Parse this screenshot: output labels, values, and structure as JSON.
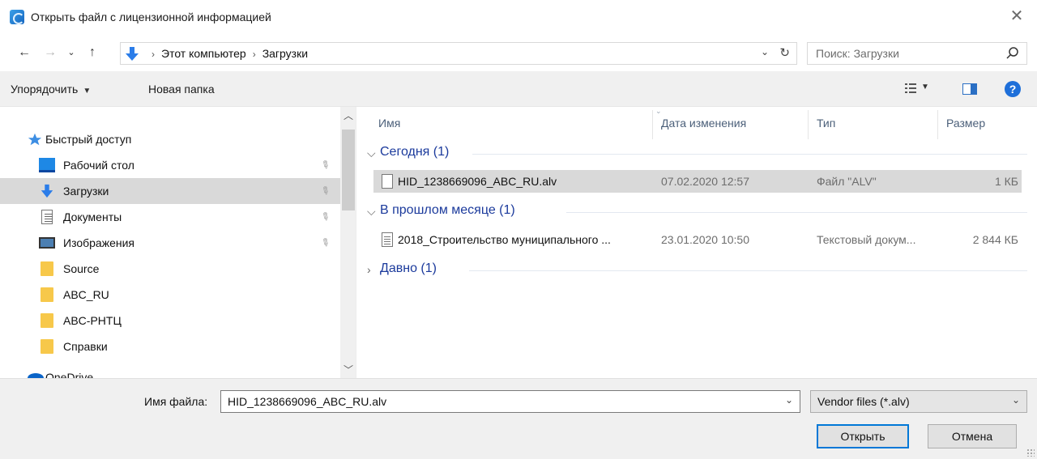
{
  "window": {
    "title": "Открыть файл с лицензионной информацией"
  },
  "navbar": {
    "breadcrumbs": [
      "Этот компьютер",
      "Загрузки"
    ],
    "search_placeholder": "Поиск: Загрузки"
  },
  "toolbar": {
    "organize_label": "Упорядочить",
    "new_folder_label": "Новая папка"
  },
  "sidebar": {
    "quick_access_label": "Быстрый доступ",
    "items": [
      {
        "label": "Рабочий стол",
        "icon": "desktop-icon",
        "pinned": true
      },
      {
        "label": "Загрузки",
        "icon": "downloads-icon",
        "pinned": true,
        "selected": true
      },
      {
        "label": "Документы",
        "icon": "documents-icon",
        "pinned": true
      },
      {
        "label": "Изображения",
        "icon": "pictures-icon",
        "pinned": true
      },
      {
        "label": "Source",
        "icon": "folder-icon",
        "pinned": false
      },
      {
        "label": "ABC_RU",
        "icon": "folder-icon",
        "pinned": false
      },
      {
        "label": "ABC-РНТЦ",
        "icon": "folder-icon",
        "pinned": false
      },
      {
        "label": "Справки",
        "icon": "folder-icon",
        "pinned": false
      },
      {
        "label": "OneDrive",
        "icon": "onedrive-icon",
        "pinned": false
      }
    ]
  },
  "filelist": {
    "columns": [
      "Имя",
      "Дата изменения",
      "Тип",
      "Размер"
    ],
    "groups": [
      {
        "label": "Сегодня (1)",
        "expanded": true,
        "rows": [
          {
            "name": "HID_1238669096_ABC_RU.alv",
            "date": "07.02.2020 12:57",
            "type": "Файл \"ALV\"",
            "size": "1 КБ",
            "selected": true
          }
        ]
      },
      {
        "label": "В прошлом месяце (1)",
        "expanded": true,
        "rows": [
          {
            "name": "2018_Строительство муниципального ...",
            "date": "23.01.2020 10:50",
            "type": "Текстовый докум...",
            "size": "2 844 КБ",
            "selected": false
          }
        ]
      },
      {
        "label": "Давно (1)",
        "expanded": false,
        "rows": []
      }
    ]
  },
  "footer": {
    "filename_label": "Имя файла:",
    "filename_value": "HID_1238669096_ABC_RU.alv",
    "filter_value": "Vendor files (*.alv)",
    "open_label": "Открыть",
    "cancel_label": "Отмена"
  },
  "colors": {
    "accent": "#0078d7",
    "group_header": "#1b3a9c",
    "selection": "#d9d9d9",
    "toolbar_bg": "#f0f0f0"
  }
}
